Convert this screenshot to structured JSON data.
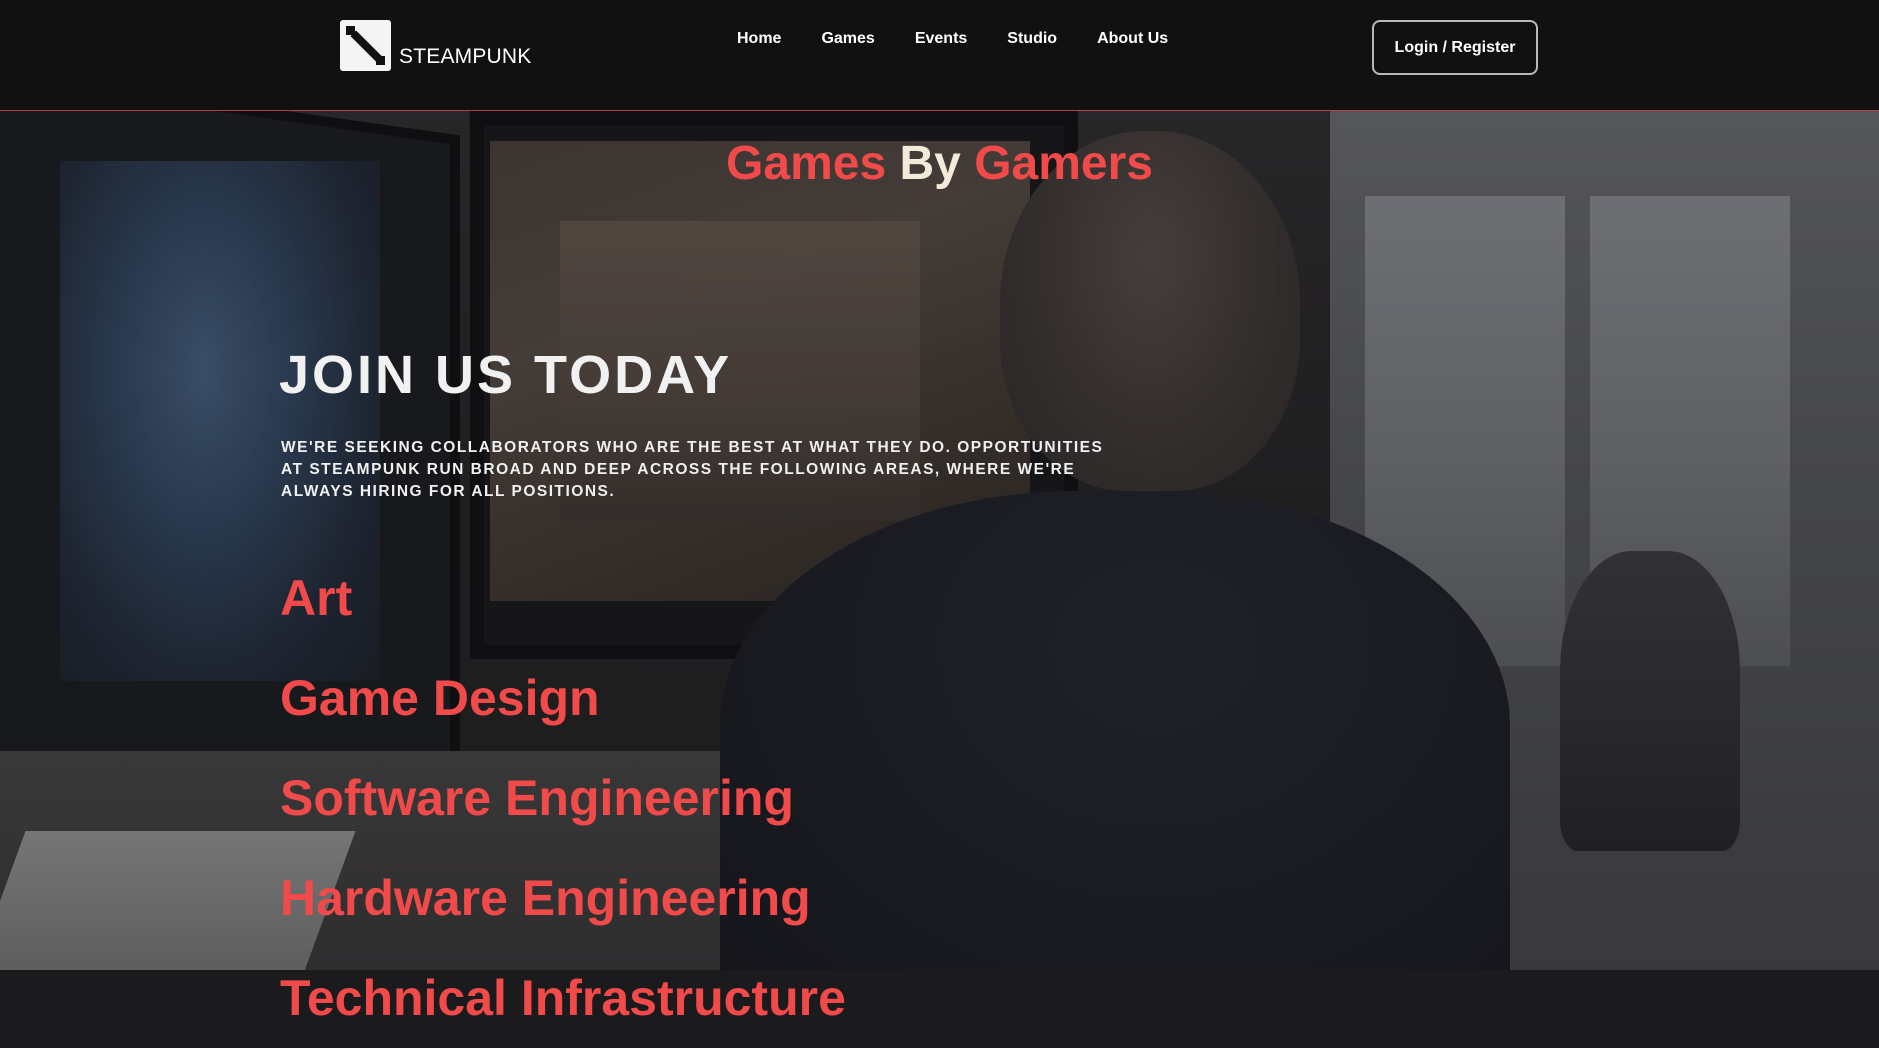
{
  "header": {
    "logo_text": "STEAMPUNK",
    "nav": [
      "Home",
      "Games",
      "Events",
      "Studio",
      "About Us"
    ],
    "login_label": "Login / Register"
  },
  "hero": {
    "title_part1": "Games",
    "title_part2": "By",
    "title_part3": "Gamers"
  },
  "join": {
    "title": "JOIN US TODAY",
    "description": "We're seeking collaborators who are the best at what they do. Opportunities at Steampunk run broad and deep across the following areas, where we're always hiring for all positions.",
    "areas": [
      "Art",
      "Game Design",
      "Software Engineering",
      "Hardware Engineering",
      "Technical Infrastructure"
    ]
  },
  "colors": {
    "accent": "#f04a4a",
    "header_bg": "#111112",
    "header_border": "#b8413f",
    "cream": "#f4ead9"
  }
}
